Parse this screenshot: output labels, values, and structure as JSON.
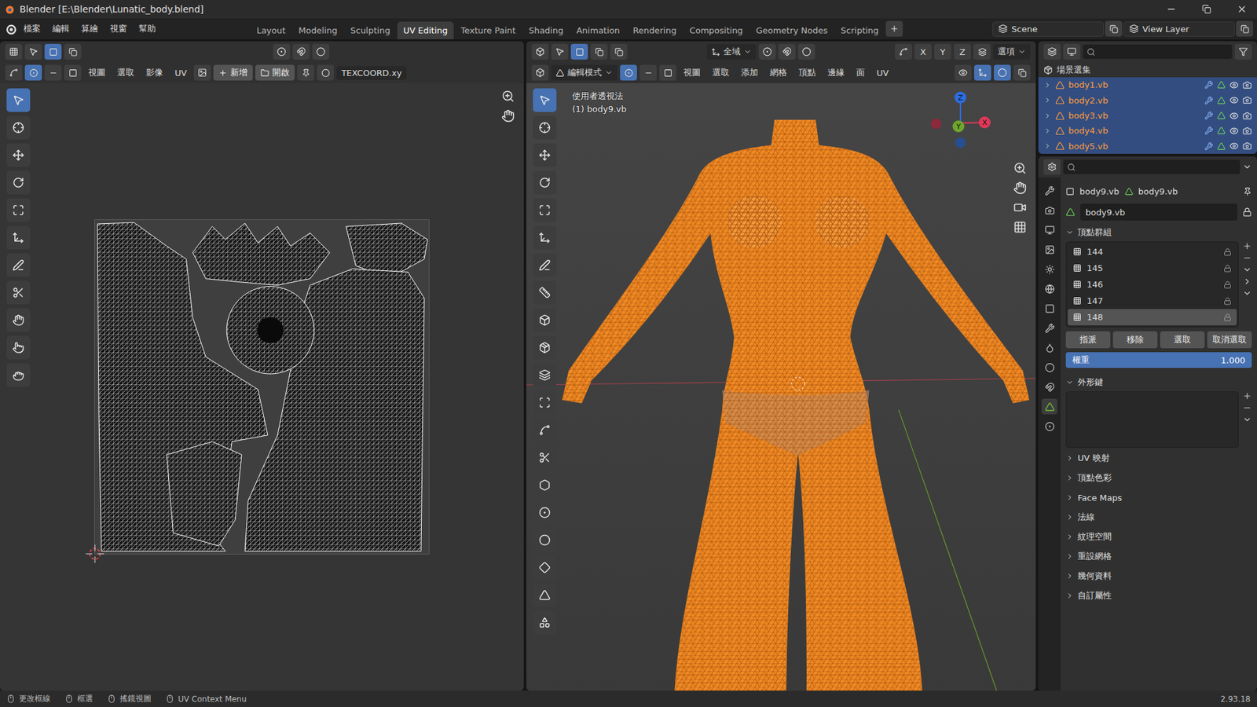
{
  "window": {
    "title": "Blender [E:\\Blender\\Lunatic_body.blend]"
  },
  "menu": [
    "檔案",
    "編輯",
    "算繪",
    "視窗",
    "幫助"
  ],
  "workspaces": [
    {
      "label": "Layout",
      "selected": false
    },
    {
      "label": "Modeling",
      "selected": false
    },
    {
      "label": "Sculpting",
      "selected": false
    },
    {
      "label": "UV Editing",
      "selected": true
    },
    {
      "label": "Texture Paint",
      "selected": false
    },
    {
      "label": "Shading",
      "selected": false
    },
    {
      "label": "Animation",
      "selected": false
    },
    {
      "label": "Rendering",
      "selected": false
    },
    {
      "label": "Compositing",
      "selected": false
    },
    {
      "label": "Geometry Nodes",
      "selected": false
    },
    {
      "label": "Scripting",
      "selected": false
    }
  ],
  "scene": "Scene",
  "view_layer": "View Layer",
  "uv_editor": {
    "menus": [
      "視圖",
      "選取",
      "影像",
      "UV"
    ],
    "new_button": "新增",
    "open_button": "開啟",
    "uv_map": "TEXCOORD.xy",
    "tools": [
      {
        "selected": true
      },
      {
        "selected": false
      },
      {
        "selected": false
      },
      {
        "selected": false
      },
      {
        "selected": false
      },
      {
        "selected": false
      },
      {
        "selected": false
      },
      {
        "selected": false
      },
      {
        "selected": false
      },
      {
        "selected": false
      },
      {
        "selected": false
      }
    ]
  },
  "viewport": {
    "mode": "編輯模式",
    "orientation": "全域",
    "options": "選項",
    "menus": [
      "視圖",
      "選取",
      "添加",
      "網格",
      "頂點",
      "邊緣",
      "面",
      "UV"
    ],
    "select_modes": [
      {
        "selected": true
      },
      {
        "selected": false
      },
      {
        "selected": false
      }
    ],
    "axes": [
      {
        "label": "X",
        "selected": false
      },
      {
        "label": "Y",
        "selected": false
      },
      {
        "label": "Z",
        "selected": false
      }
    ],
    "overlay_title": "使用者透視法",
    "overlay_object": "(1) body9.vb",
    "gizmo": [
      {
        "label": "Z",
        "color": "#2c6de0"
      },
      {
        "label": "Y",
        "color": "#6fa62c"
      },
      {
        "label": "X",
        "color": "#e0385a"
      }
    ],
    "tools": [
      {
        "selected": true
      },
      {
        "selected": false
      },
      {
        "selected": false
      },
      {
        "selected": false
      },
      {
        "selected": false
      },
      {
        "selected": false
      },
      {
        "selected": false
      },
      {
        "selected": false
      },
      {
        "selected": false
      },
      {
        "selected": false
      },
      {
        "selected": false
      },
      {
        "selected": false
      },
      {
        "selected": false
      },
      {
        "selected": false
      },
      {
        "selected": false
      },
      {
        "selected": false
      },
      {
        "selected": false
      },
      {
        "selected": false
      },
      {
        "selected": false
      },
      {
        "selected": false
      }
    ]
  },
  "outliner": {
    "root": "場景選集",
    "items": [
      {
        "name": "body1.vb",
        "selected": true
      },
      {
        "name": "body2.vb",
        "selected": true
      },
      {
        "name": "body3.vb",
        "selected": true
      },
      {
        "name": "body4.vb",
        "selected": true
      },
      {
        "name": "body5.vb",
        "selected": true
      }
    ]
  },
  "properties": {
    "object": "body9.vb",
    "data": "body9.vb",
    "mesh_name": "body9.vb",
    "tabs": [
      {
        "selected": false
      },
      {
        "selected": false
      },
      {
        "selected": false
      },
      {
        "selected": false
      },
      {
        "selected": false
      },
      {
        "selected": false
      },
      {
        "selected": false
      },
      {
        "selected": false
      },
      {
        "selected": false
      },
      {
        "selected": false
      },
      {
        "selected": false
      },
      {
        "selected": true
      },
      {
        "selected": false
      }
    ],
    "panels": [
      {
        "kind": "vertex_groups",
        "label": "頂點群組",
        "expanded": true
      },
      {
        "kind": "shape_keys",
        "label": "外形鍵",
        "expanded": true
      },
      {
        "kind": "collapsed",
        "label": "UV 映射",
        "expanded": false
      },
      {
        "kind": "collapsed",
        "label": "頂點色彩",
        "expanded": false
      },
      {
        "kind": "collapsed",
        "label": "Face Maps",
        "expanded": false
      },
      {
        "kind": "collapsed",
        "label": "法線",
        "expanded": false
      },
      {
        "kind": "collapsed",
        "label": "紋理空間",
        "expanded": false
      },
      {
        "kind": "collapsed",
        "label": "重設網格",
        "expanded": false
      },
      {
        "kind": "collapsed",
        "label": "幾何資料",
        "expanded": false
      },
      {
        "kind": "collapsed",
        "label": "自訂屬性",
        "expanded": false
      }
    ],
    "vertex_groups": [
      {
        "name": "144",
        "selected": false
      },
      {
        "name": "145",
        "selected": false
      },
      {
        "name": "146",
        "selected": false
      },
      {
        "name": "147",
        "selected": false
      },
      {
        "name": "148",
        "selected": true
      }
    ],
    "vg_buttons": [
      "指派",
      "移除",
      "選取",
      "取消選取"
    ],
    "weight": {
      "label": "權重",
      "reading": "1.000",
      "level": 1
    }
  },
  "status_bar": {
    "items": [
      "更改框線",
      "框選",
      "搖鏡視圖",
      "UV Context Menu"
    ],
    "version": "2.93.18"
  }
}
